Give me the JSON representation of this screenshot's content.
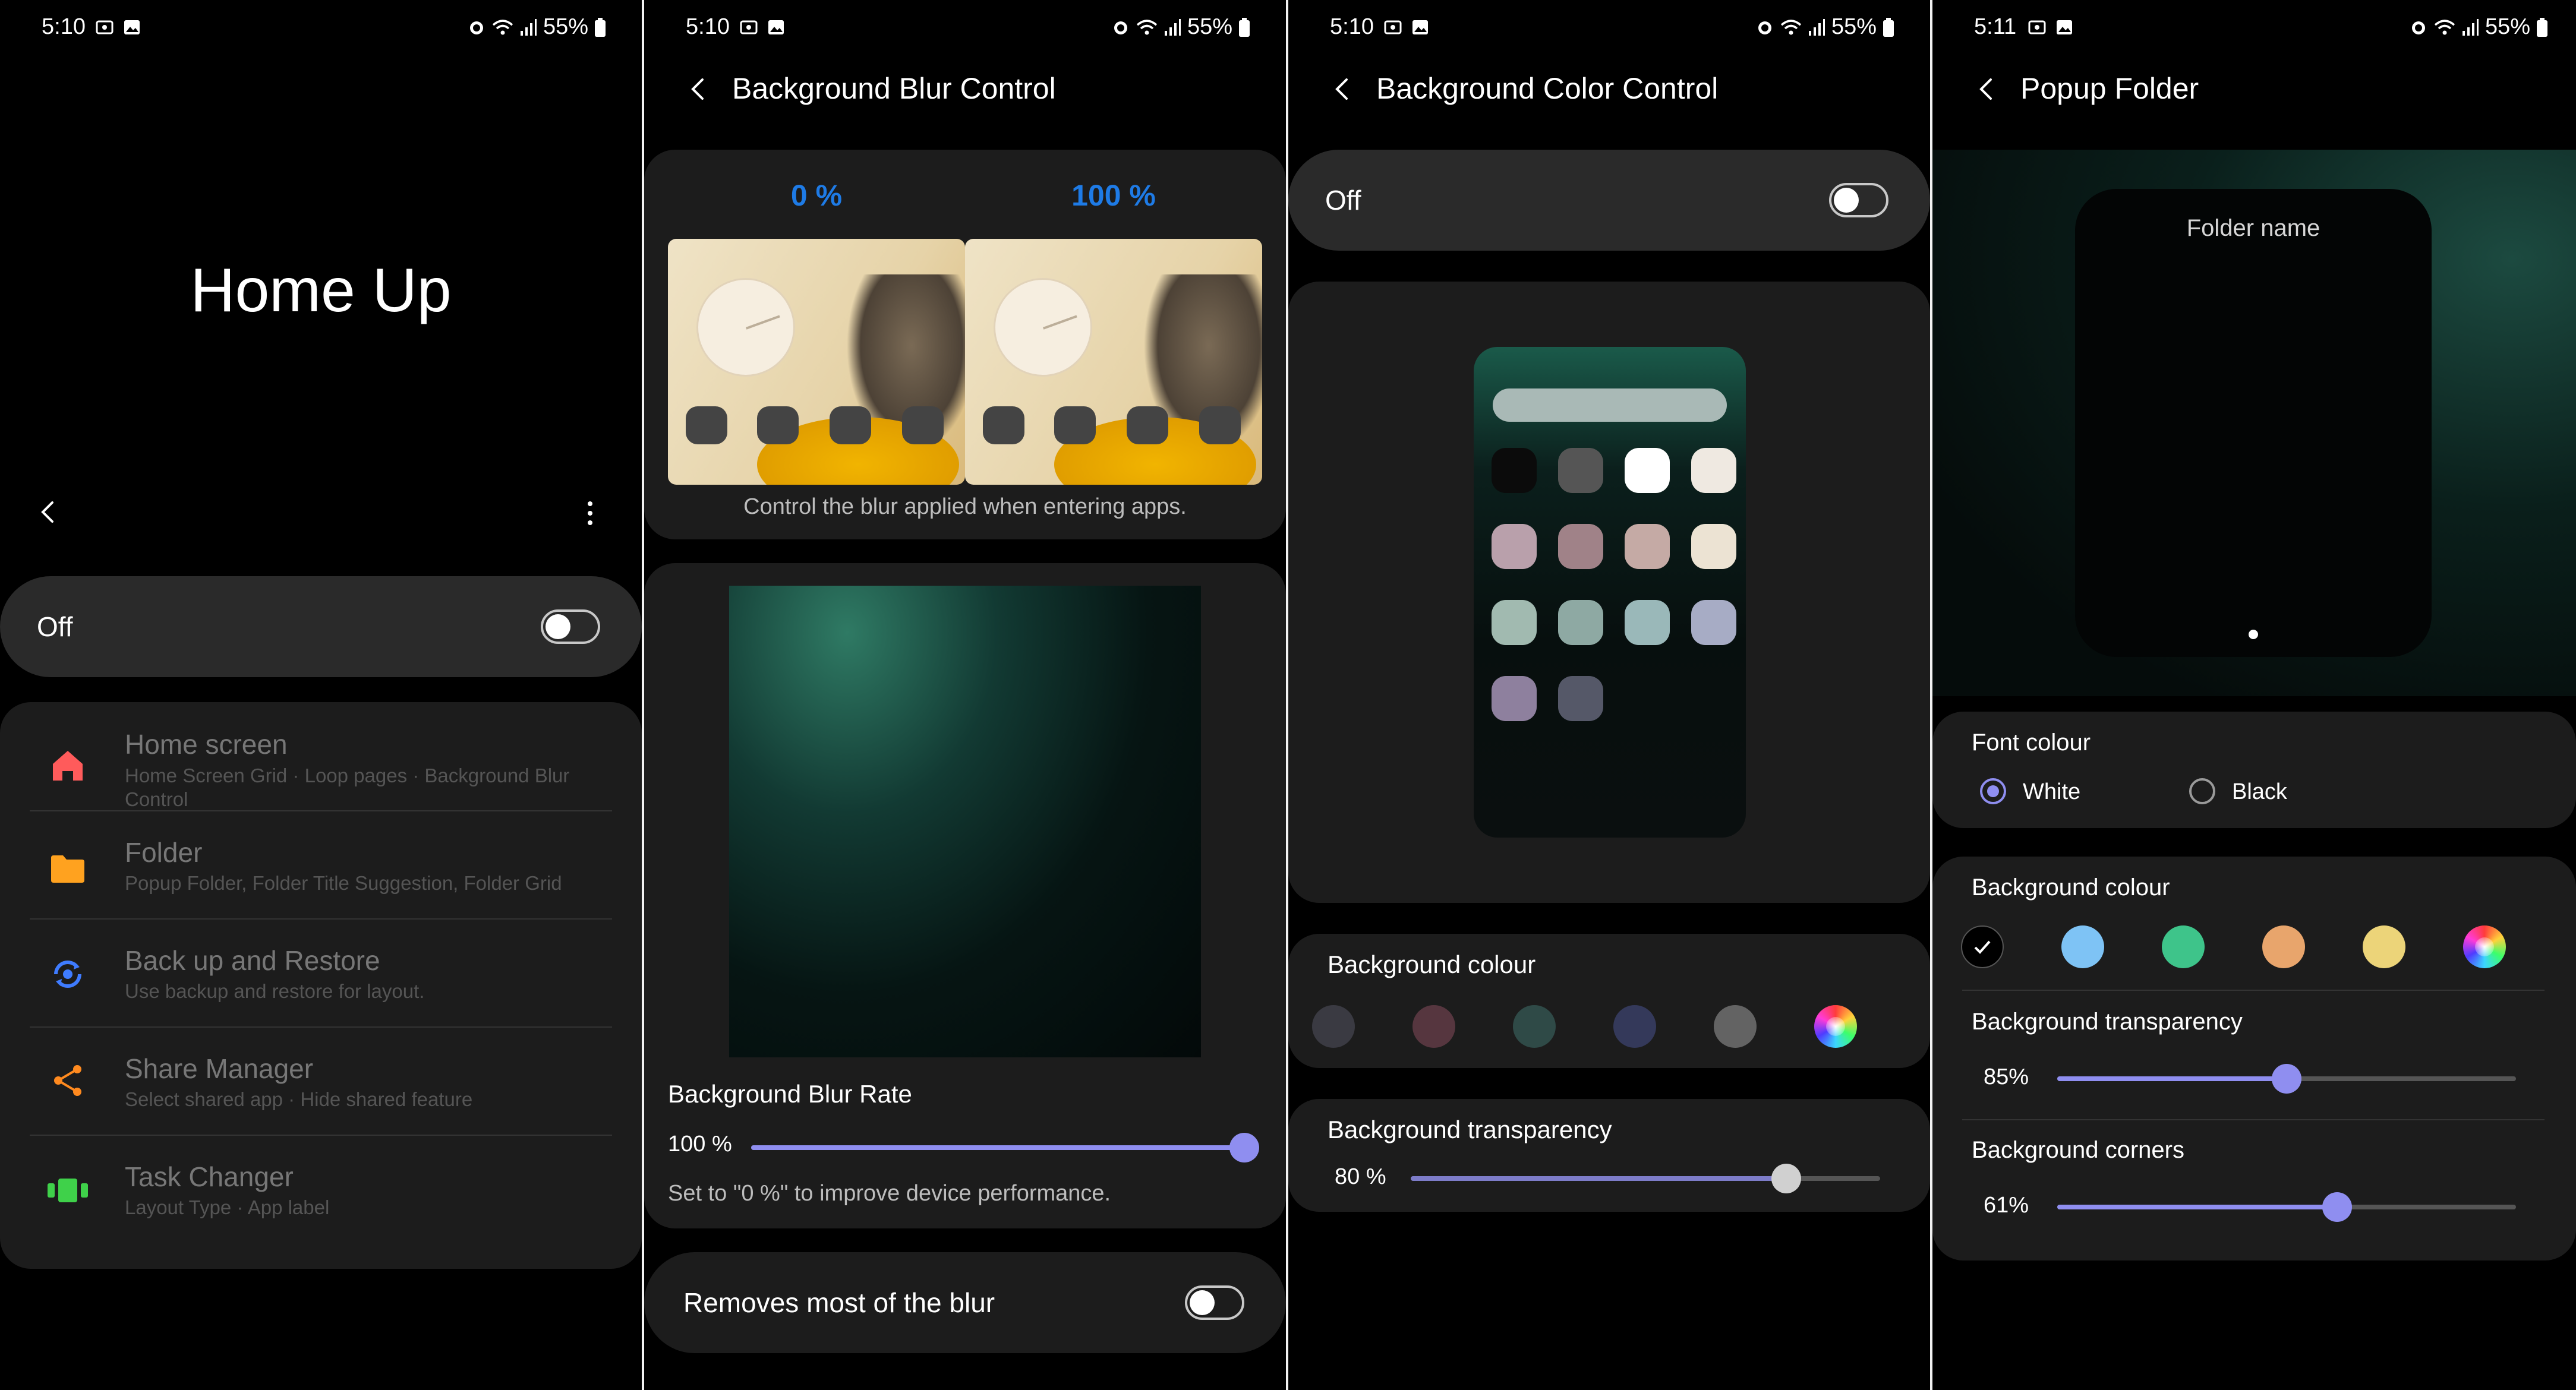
{
  "status_bars": [
    {
      "time": "5:10",
      "battery": "55%"
    },
    {
      "time": "5:10",
      "battery": "55%"
    },
    {
      "time": "5:10",
      "battery": "55%"
    },
    {
      "time": "5:11",
      "battery": "55%"
    }
  ],
  "home_up": {
    "title": "Home Up",
    "toggle_label": "Off",
    "toggle_on": false,
    "items": [
      {
        "title": "Home screen",
        "subtitle": "Home Screen Grid · Loop pages · Background Blur Control",
        "icon": "home-icon",
        "color": "#ff5b5b"
      },
      {
        "title": "Folder",
        "subtitle": "Popup Folder, Folder Title Suggestion, Folder Grid",
        "icon": "folder-icon",
        "color": "#ffa21f"
      },
      {
        "title": "Back up and Restore",
        "subtitle": "Use backup and restore for layout.",
        "icon": "backup-restore-icon",
        "color": "#3f7cff"
      },
      {
        "title": "Share Manager",
        "subtitle": "Select shared app · Hide shared feature",
        "icon": "share-icon",
        "color": "#ff8a1f"
      },
      {
        "title": "Task Changer",
        "subtitle": "Layout Type · App label",
        "icon": "task-changer-icon",
        "color": "#3fd14a"
      }
    ]
  },
  "blur_control": {
    "title": "Background Blur Control",
    "preview_left_label": "0 %",
    "preview_right_label": "100 %",
    "preview_caption": "Control the blur applied when entering apps.",
    "rate_label": "Background Blur Rate",
    "rate_value": "100 %",
    "rate_fraction": 1.0,
    "hint": "Set to \"0 %\" to improve device performance.",
    "remove_label": "Removes most of the blur",
    "remove_on": false
  },
  "color_control": {
    "title": "Background Color Control",
    "toggle_label": "Off",
    "toggle_on": false,
    "bg_colour_label": "Background colour",
    "bg_colours": [
      "#3a3a42",
      "#56363f",
      "#2f4a47",
      "#34395a",
      "#636363"
    ],
    "preview_swatches": [
      "#0b0b0b",
      "#555555",
      "#ffffff",
      "#efe9e1",
      "#b9a0ab",
      "#a08288",
      "#c5aaa5",
      "#ece3d3",
      "#a1bab0",
      "#8ea9a3",
      "#9ab8b9",
      "#a7acc5",
      "#8e809e",
      "#555868"
    ],
    "transparency_label": "Background transparency",
    "transparency_value": "80 %",
    "transparency_fraction": 0.8
  },
  "popup_folder": {
    "title": "Popup Folder",
    "folder_name": "Folder name",
    "font_colour_label": "Font colour",
    "font_options": [
      "White",
      "Black"
    ],
    "font_selected": "White",
    "bg_colour_label": "Background colour",
    "bg_colours": [
      "#000000",
      "#7ec3f5",
      "#3ec48a",
      "#e8a56c",
      "#ecd479"
    ],
    "bg_colour_selected_index": 0,
    "transparency_label": "Background transparency",
    "transparency_value": "85%",
    "transparency_fraction": 0.5,
    "corners_label": "Background corners",
    "corners_value": "61%",
    "corners_fraction": 0.61
  },
  "colors": {
    "accent": "#8f8ef0",
    "blue_label": "#1e7be6",
    "card": "#1c1c1c"
  }
}
